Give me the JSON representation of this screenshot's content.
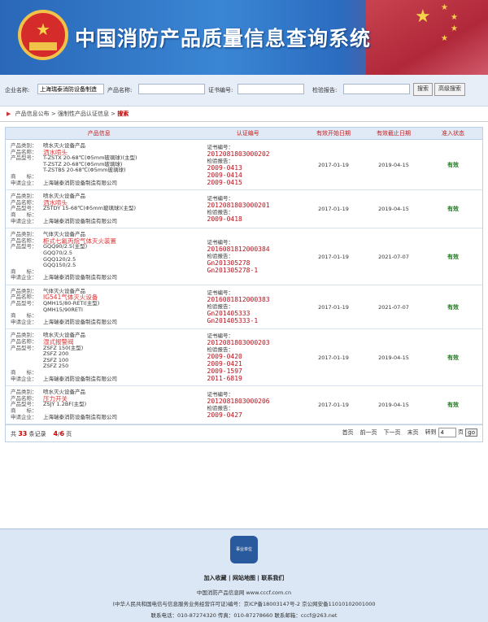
{
  "header": {
    "title": "中国消防产品质量信息查询系统"
  },
  "search": {
    "enterprise_label": "企业名称:",
    "enterprise_value": "上海瑞泰消防设备制造",
    "product_label": "产品名称:",
    "cert_label": "证书编号:",
    "report_label": "检验报告:",
    "search_btn": "搜索",
    "advanced_btn": "高级搜索"
  },
  "breadcrumb": [
    "产品信息公布",
    "强制性产品认证信息",
    "搜索"
  ],
  "table": {
    "headers": [
      "产品信息",
      "认证编号",
      "有效开始日期",
      "有效截止日期",
      "准入状态"
    ],
    "rows": [
      {
        "category": "喷水灭火设备产品",
        "name": "洒水喷头",
        "models": [
          "T-ZSTX 20-68℃(Φ5mm玻璃球)(主型)",
          "T-ZSTZ 20-68℃(Φ5mm玻璃球)",
          "T-ZSTBS 20-68℃(Φ5mm玻璃球)"
        ],
        "trademark": "",
        "applicant": "上海瑞泰消防设备制造有限公司",
        "cert_label": "证书编号：",
        "cert_no": "2012081803000202",
        "report_label": "检验报告：",
        "reports": [
          "2009-0413",
          "2009-0414",
          "2009-0415"
        ],
        "start": "2017-01-19",
        "end": "2019-04-15",
        "status": "有效"
      },
      {
        "category": "喷水灭火设备产品",
        "name": "洒水喷头",
        "models": [
          "ZSTDY 15-68℃(Φ5mm玻璃球)(主型)"
        ],
        "trademark": "",
        "applicant": "上海瑞泰消防设备制造有限公司",
        "cert_label": "证书编号：",
        "cert_no": "2012081803000201",
        "report_label": "检验报告：",
        "reports": [
          "2009-0418"
        ],
        "start": "2017-01-19",
        "end": "2019-04-15",
        "status": "有效"
      },
      {
        "category": "气体灭火设备产品",
        "name": "柜式七氟丙烷气体灭火装置",
        "models": [
          "GQQ90/2.5(主型)",
          "GQQ70/2.5",
          "GQQ120/2.5",
          "GQQ150/2.5"
        ],
        "trademark": "",
        "applicant": "上海瑞泰消防设备制造有限公司",
        "cert_label": "证书编号：",
        "cert_no": "2016081812000384",
        "report_label": "检验报告：",
        "reports": [
          "Gn201305278",
          "Gn201305278-1"
        ],
        "start": "2017-01-19",
        "end": "2021-07-07",
        "status": "有效"
      },
      {
        "category": "气体灭火设备产品",
        "name": "IG541气体灭火设备",
        "models": [
          "QMH15/80-RETI(主型)",
          "QMH15/90RETI"
        ],
        "trademark": "",
        "applicant": "上海瑞泰消防设备制造有限公司",
        "cert_label": "证书编号：",
        "cert_no": "2016081812000383",
        "report_label": "检验报告：",
        "reports": [
          "Gn201405333",
          "Gn201405333-1"
        ],
        "start": "2017-01-19",
        "end": "2021-07-07",
        "status": "有效"
      },
      {
        "category": "喷水灭火设备产品",
        "name": "湿式报警阀",
        "models": [
          "ZSFZ 150(主型)",
          "ZSFZ 200",
          "ZSFZ 100",
          "ZSFZ 250"
        ],
        "trademark": "",
        "applicant": "上海瑞泰消防设备制造有限公司",
        "cert_label": "证书编号：",
        "cert_no": "2012081803000203",
        "report_label": "检验报告：",
        "reports": [
          "2009-0420",
          "2009-0421",
          "2009-1597",
          "2011-6819"
        ],
        "start": "2017-01-19",
        "end": "2019-04-15",
        "status": "有效"
      },
      {
        "category": "喷水灭火设备产品",
        "name": "压力开关",
        "models": [
          "ZSJY 1.2BF(主型)"
        ],
        "trademark": "",
        "applicant": "上海瑞泰消防设备制造有限公司",
        "cert_label": "证书编号：",
        "cert_no": "2012081803000206",
        "report_label": "检验报告：",
        "reports": [
          "2009-0427"
        ],
        "start": "2017-01-19",
        "end": "2019-04-15",
        "status": "有效"
      }
    ],
    "labels": {
      "category": "产品类别：",
      "name": "产品名称：",
      "model": "产品型号：",
      "trademark": "商　　标：",
      "applicant": "申请企业："
    }
  },
  "pager": {
    "total_prefix": "共",
    "total_count": "33",
    "total_suffix": "条记录",
    "page_current": "4",
    "page_sep": "/",
    "page_total": "6",
    "page_suffix": "页",
    "first": "首页",
    "prev": "前一页",
    "next": "下一页",
    "last": "末页",
    "goto_label": "转到",
    "goto_value": "4",
    "page_unit": "页",
    "go": "go"
  },
  "footer": {
    "badge": "事业单位",
    "links": "加入收藏 | 网站地图 | 联系我们",
    "line1": "中国消防产品信息网 www.cccf.com.cn",
    "line2": "(中华人民共和国电信与信息服务业务经营许可证)编号：京ICP备18003147号-2 京公网安备11010102001000",
    "line3": "联系电话：010-87274320 传真：010-87278660 联系邮箱：cccf@263.net"
  }
}
